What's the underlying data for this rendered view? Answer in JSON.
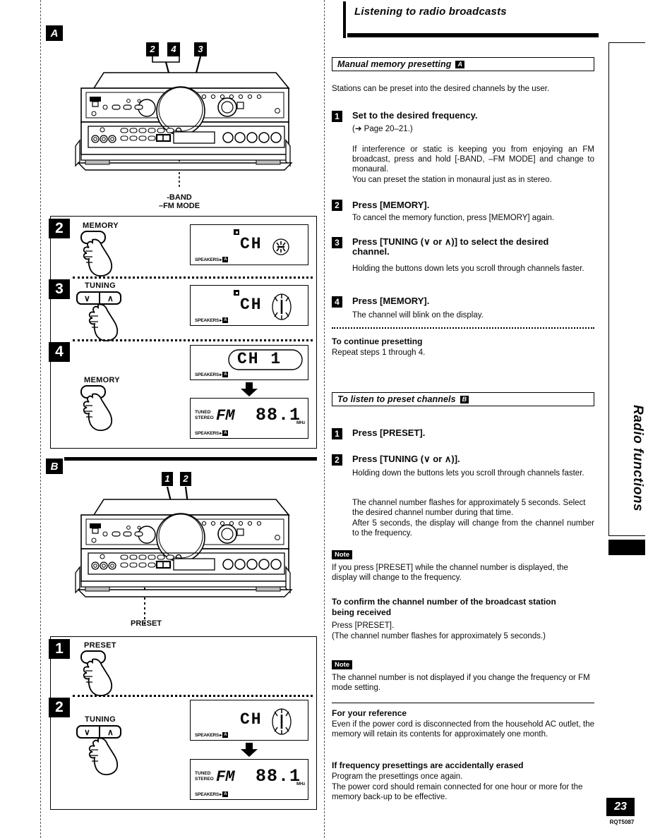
{
  "header": {
    "title": "Listening to radio broadcasts"
  },
  "sidetab": {
    "label": "Radio functions",
    "page_number": "23",
    "doc_code": "RQT5087"
  },
  "sections": [
    {
      "id": "manual-memory-presetting",
      "heading": "Manual memory presetting",
      "badge": "A",
      "intro": "Stations can be preset into the desired channels by the user.",
      "steps": [
        {
          "num": "1",
          "title": "Set to the desired frequency.",
          "ref": "(➔ Page 20–21.)",
          "body": "If interference or static is keeping you from enjoying an FM broadcast, press and hold [-BAND, –FM MODE] and change to monaural.",
          "body2": "You can preset the station in monaural just as in stereo."
        },
        {
          "num": "2",
          "title": "Press [MEMORY].",
          "body": "To cancel the memory function, press [MEMORY] again."
        },
        {
          "num": "3",
          "title": "Press [TUNING (∨ or ∧)] to select the desired channel.",
          "body": "Holding the buttons down lets you scroll through channels faster."
        },
        {
          "num": "4",
          "title": "Press [MEMORY].",
          "body": "The channel will blink on the display."
        }
      ],
      "footer_head": "To continue presetting",
      "footer_body": "Repeat steps 1 through 4."
    },
    {
      "id": "to-listen-to-preset-channels",
      "heading": "To listen to preset channels",
      "badge": "B",
      "steps": [
        {
          "num": "1",
          "title": "Press [PRESET]."
        },
        {
          "num": "2",
          "title": "Press [TUNING (∨ or ∧)].",
          "body": "Holding down the buttons lets you scroll through channels faster.",
          "body2": "The channel number flashes for approximately 5 seconds. Select the desired channel number during that time.",
          "body3": "After 5 seconds, the display will change from the channel number to the frequency."
        }
      ],
      "notes": [
        {
          "tag": "Note",
          "text": "If you press [PRESET] while the channel number is displayed, the display will change to the frequency."
        },
        {
          "tag": "Note",
          "text": "The channel number is not displayed if you change the frequency or FM mode setting."
        }
      ],
      "confirm_head": "To confirm the channel number of the broadcast station being received",
      "confirm_body": "Press [PRESET].",
      "confirm_body2": "(The channel number flashes for approximately 5 seconds.)",
      "reference_head": "For your reference",
      "reference_body": "Even if the power cord is disconnected from the household AC outlet, the memory will retain its contents for approximately one month.",
      "erased_head": "If frequency presettings are accidentally erased",
      "erased_body": "Program the presettings once again.",
      "erased_body2": "The power cord should remain connected for one hour or more for the memory back-up to be effective."
    }
  ],
  "figures": {
    "a": {
      "badge": "A",
      "callouts": [
        "2",
        "4",
        "3"
      ],
      "caption_line1": "-BAND",
      "caption_line2": "–FM MODE",
      "steps": [
        {
          "num": "2",
          "button_label": "MEMORY",
          "display": {
            "ch_text": "CH",
            "memory_icon": "memory-icon",
            "blink_marker": "blinking-dash",
            "speakers_label": "SPEAKERS",
            "speakers_channel": "A"
          }
        },
        {
          "num": "3",
          "button_label": "TUNING",
          "button_down": "∨",
          "button_up": "∧",
          "display": {
            "ch_text": "CH",
            "memory_icon": "memory-icon",
            "blink_marker": "blinking-1",
            "speakers_label": "SPEAKERS",
            "speakers_channel": "A"
          }
        },
        {
          "num": "4",
          "button_label": "MEMORY",
          "display": {
            "ch_text": "CH  1",
            "speakers_label": "SPEAKERS",
            "speakers_channel": "A"
          },
          "display2": {
            "tuned": "TUNED",
            "stereo": "STEREO",
            "band": "FM",
            "frequency": "88.1",
            "unit": "MHz",
            "speakers_label": "SPEAKERS",
            "speakers_channel": "A"
          }
        }
      ]
    },
    "b": {
      "badge": "B",
      "callouts": [
        "1",
        "2"
      ],
      "caption_line1": "PRESET",
      "steps": [
        {
          "num": "1",
          "button_label": "PRESET"
        },
        {
          "num": "2",
          "button_label": "TUNING",
          "button_down": "∨",
          "button_up": "∧",
          "display": {
            "ch_text": "CH",
            "blink_marker": "blinking-1",
            "speakers_label": "SPEAKERS",
            "speakers_channel": "A"
          },
          "display2": {
            "tuned": "TUNED",
            "stereo": "STEREO",
            "band": "FM",
            "frequency": "88.1",
            "unit": "MHz",
            "speakers_label": "SPEAKERS",
            "speakers_channel": "A"
          }
        }
      ]
    }
  }
}
